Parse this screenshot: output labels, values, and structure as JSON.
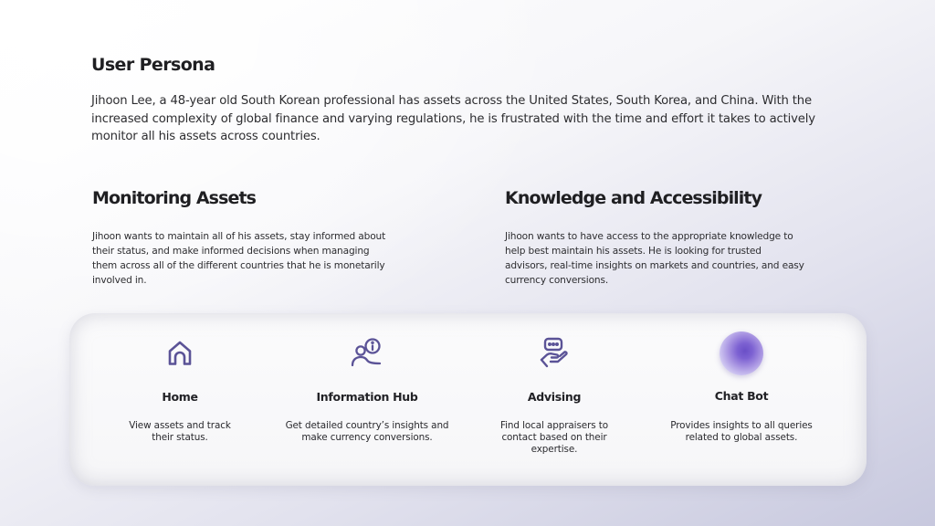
{
  "persona": {
    "title": "User Persona",
    "description": "Jihoon Lee, a 48-year old South Korean professional has assets across the United States, South Korea, and China. With the increased complexity of global finance and varying regulations, he is frustrated with the time and effort it takes to actively monitor all his assets across countries."
  },
  "sections": [
    {
      "heading": "Monitoring Assets",
      "body": "Jihoon wants to maintain all of his assets, stay informed about their status, and make informed decisions when managing them across all of the different countries that he is monetarily involved in."
    },
    {
      "heading": "Knowledge and Accessibility",
      "body": "Jihoon wants to have access to the appropriate knowledge to help best maintain his assets. He is looking for trusted advisors, real-time insights on markets and countries, and easy currency conversions."
    }
  ],
  "features": [
    {
      "icon": "home-icon",
      "title": "Home",
      "description": "View assets and track their status."
    },
    {
      "icon": "information-hub-icon",
      "title": "Information Hub",
      "description": "Get detailed country’s insights and make  currency conversions."
    },
    {
      "icon": "advising-icon",
      "title": "Advising",
      "description": "Find local appraisers to contact based on their expertise."
    },
    {
      "icon": "chat-bot-orb-icon",
      "title": "Chat Bot",
      "description": "Provides insights to all queries related to global assets."
    }
  ],
  "colors": {
    "icon_stroke": "#5b5397",
    "text": "#2b2b2e",
    "orb": "#6a4fc7"
  }
}
